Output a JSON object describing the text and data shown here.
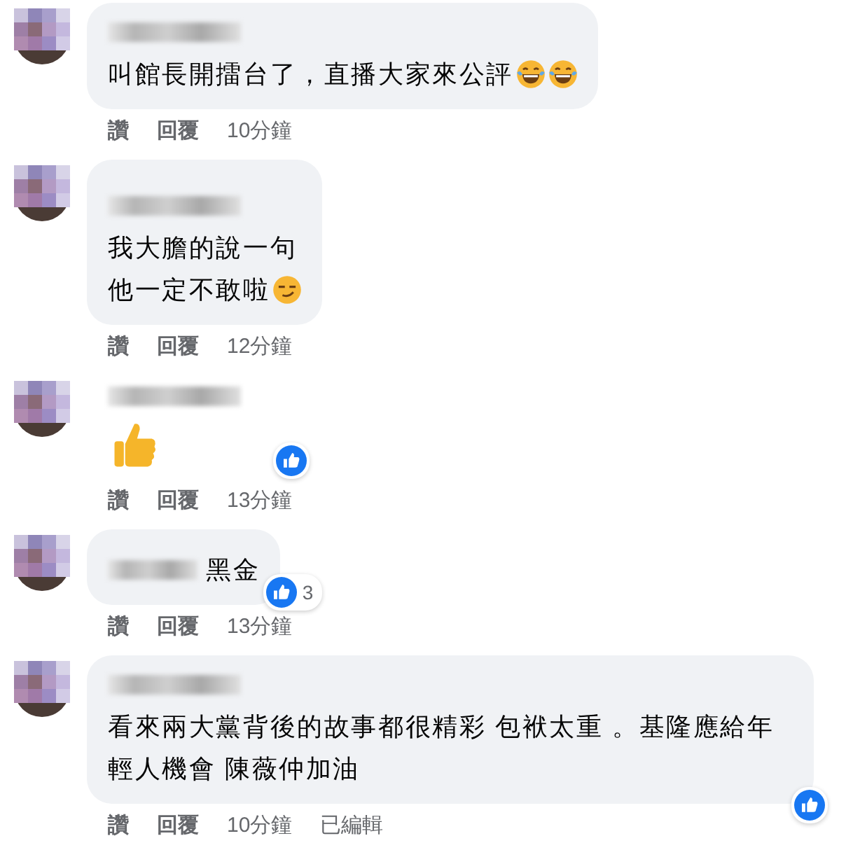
{
  "comments": [
    {
      "bubble": true,
      "lines": [
        "叫館長開擂台了，直播大家來公評"
      ],
      "emojis": [
        {
          "kind": "tears-of-joy"
        },
        {
          "kind": "tears-of-joy"
        }
      ],
      "actions": [
        "讚",
        "回覆",
        "10分鐘"
      ]
    },
    {
      "bubble": true,
      "lines": [
        "我大膽的說一句",
        "他一定不敢啦"
      ],
      "emojis": [
        {
          "kind": "smirk"
        }
      ],
      "actions": [
        "讚",
        "回覆",
        "12分鐘"
      ]
    },
    {
      "bubble": false,
      "big_emoji": {
        "kind": "thumbs-up"
      },
      "reaction": {
        "kind": "like"
      },
      "actions": [
        "讚",
        "回覆",
        "13分鐘"
      ]
    },
    {
      "bubble": true,
      "lines": [
        "黑金"
      ],
      "inline_name": true,
      "reaction": {
        "kind": "like",
        "count": "3"
      },
      "actions": [
        "讚",
        "回覆",
        "13分鐘"
      ]
    },
    {
      "bubble": true,
      "lines": [
        "看來兩大黨背後的故事都很精彩 包袱太重 。基隆應給年輕人機會 陳薇仲加油"
      ],
      "reaction": {
        "kind": "like"
      },
      "actions": [
        "讚",
        "回覆",
        "10分鐘",
        "已編輯"
      ]
    }
  ]
}
